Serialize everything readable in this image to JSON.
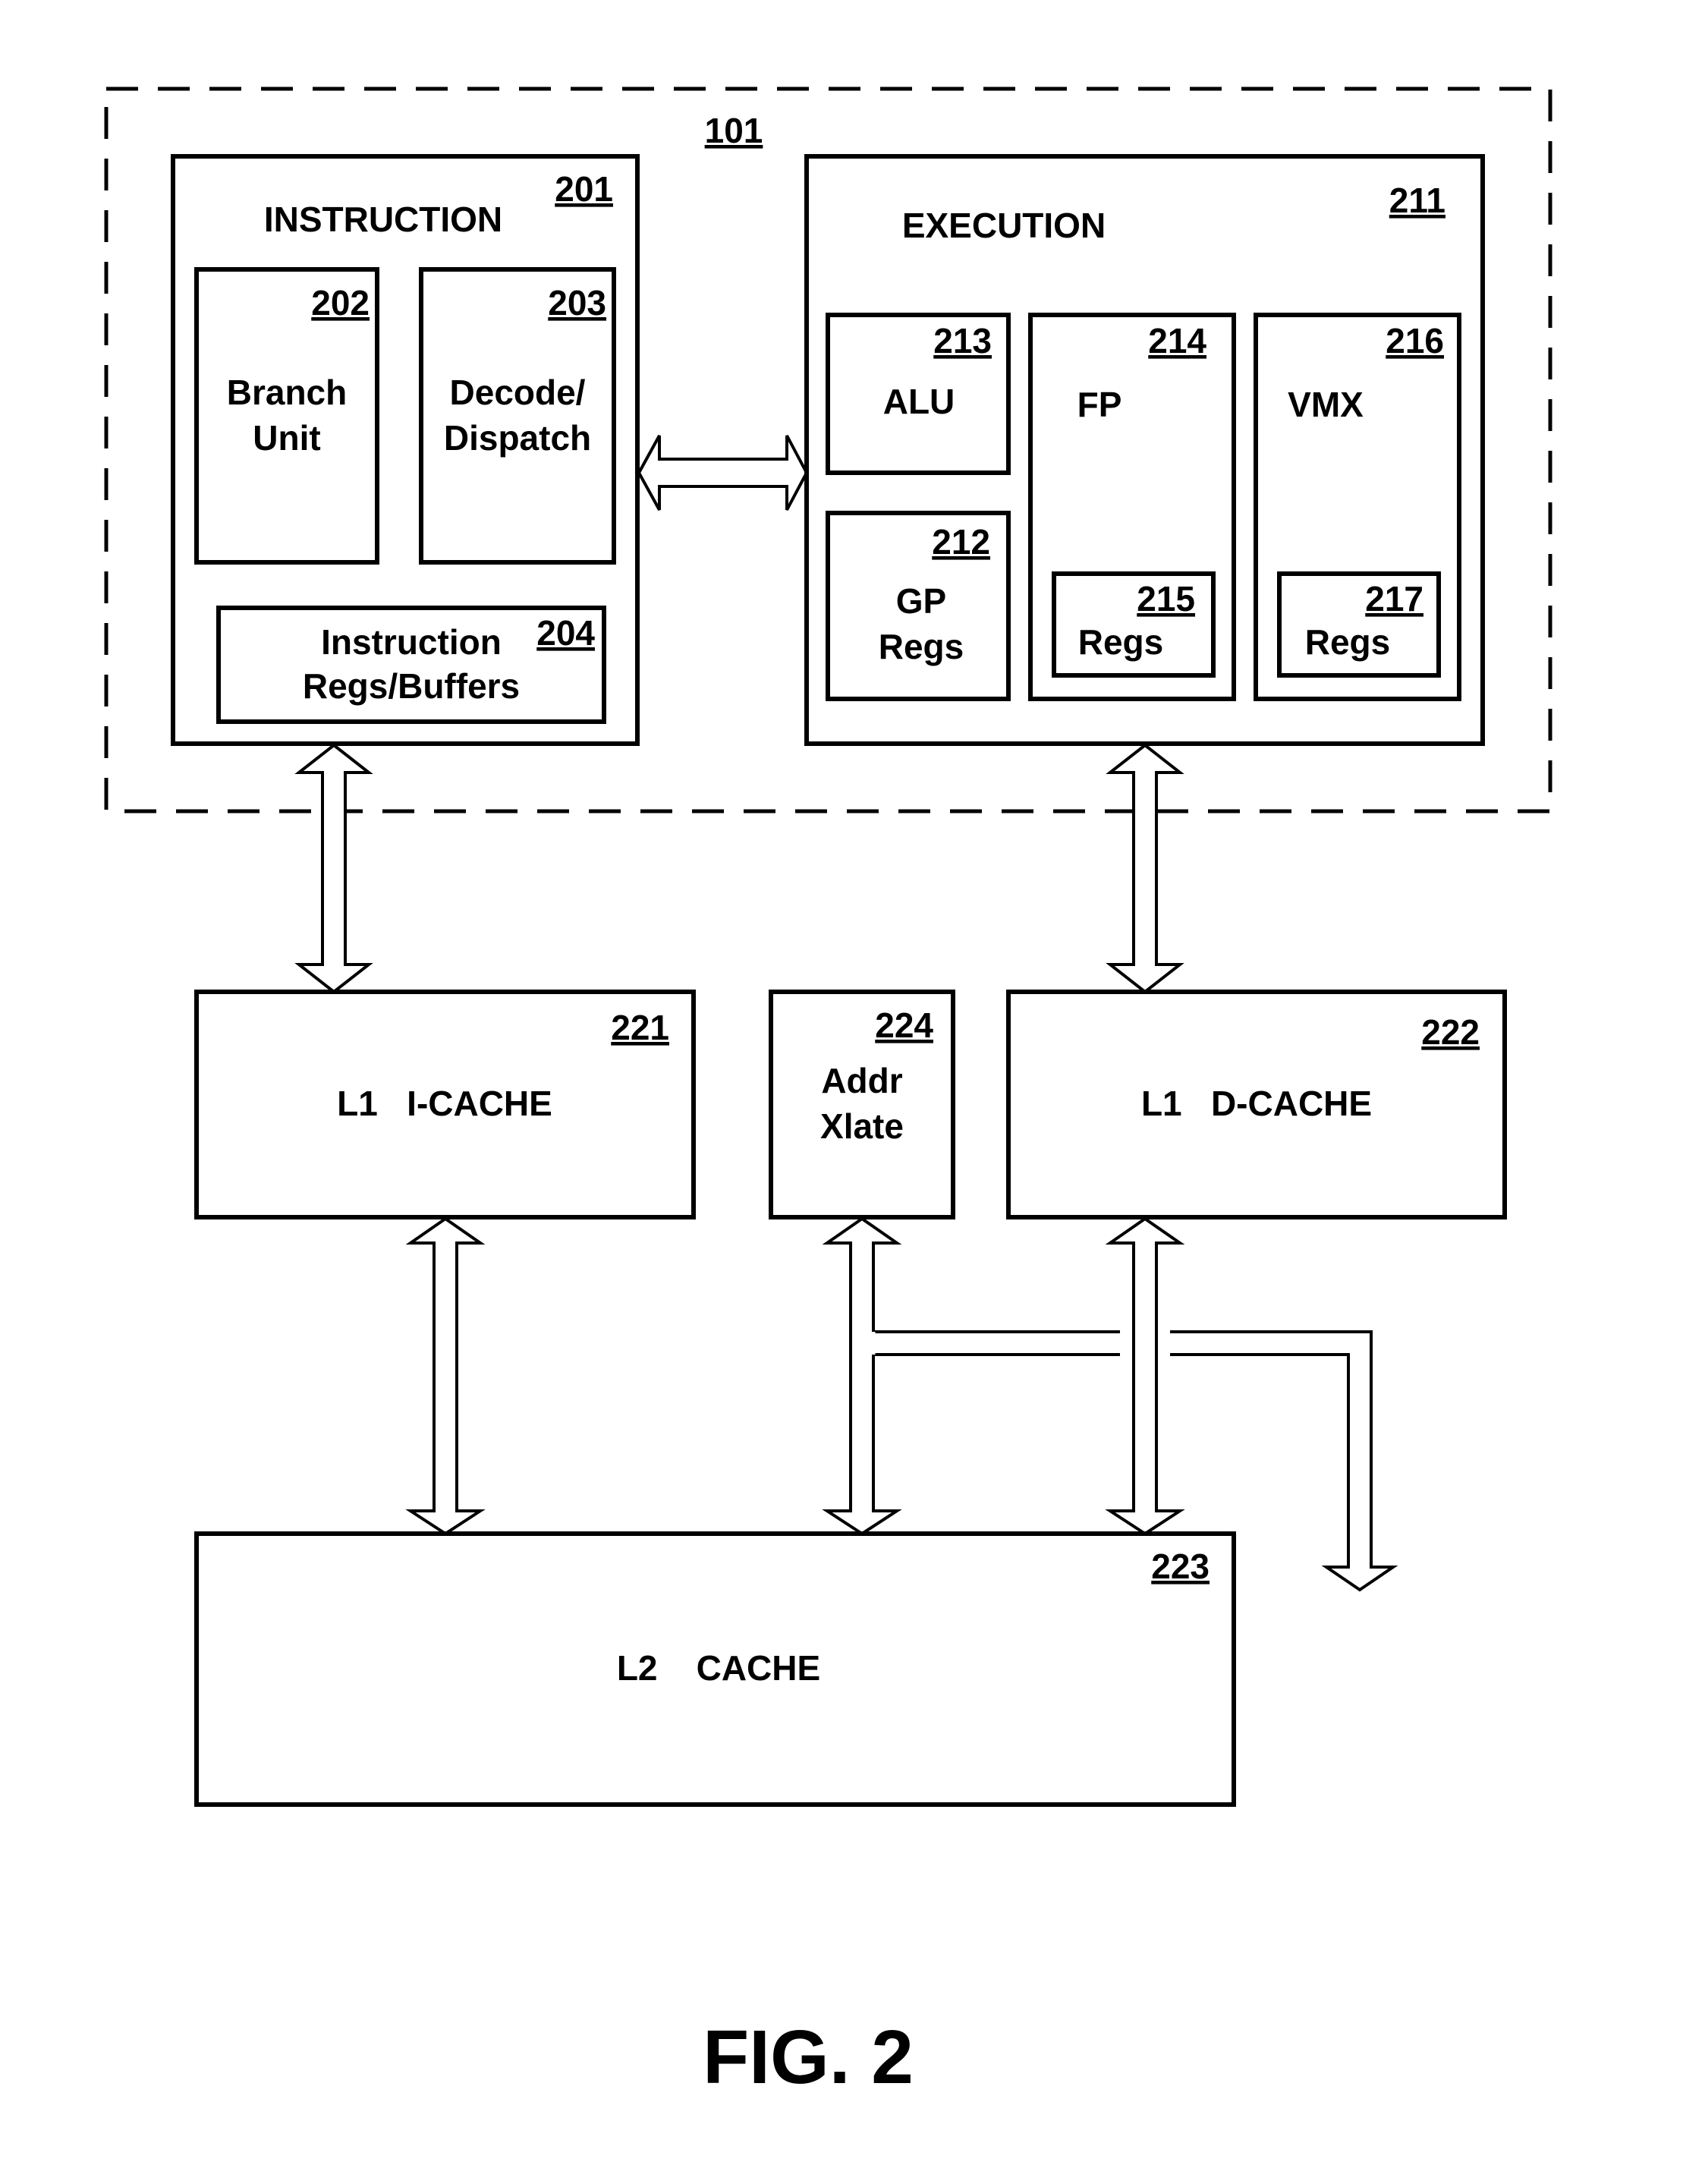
{
  "figure": {
    "caption": "FIG. 2",
    "processor_ref": "101"
  },
  "instruction_unit": {
    "ref": "201",
    "title": "INSTRUCTION",
    "branch_unit": {
      "ref": "202",
      "line1": "Branch",
      "line2": "Unit"
    },
    "decode_dispatch": {
      "ref": "203",
      "line1": "Decode/",
      "line2": "Dispatch"
    },
    "instr_regs": {
      "ref": "204",
      "line1": "Instruction",
      "line2": "Regs/Buffers"
    }
  },
  "execution_unit": {
    "ref": "211",
    "title": "EXECUTION",
    "alu": {
      "ref": "213",
      "label": "ALU"
    },
    "gp_regs": {
      "ref": "212",
      "line1": "GP",
      "line2": "Regs"
    },
    "fp": {
      "ref": "214",
      "label": "FP",
      "regs_ref": "215",
      "regs_label": "Regs"
    },
    "vmx": {
      "ref": "216",
      "label": "VMX",
      "regs_ref": "217",
      "regs_label": "Regs"
    }
  },
  "caches": {
    "l1_icache": {
      "ref": "221",
      "label": "L1   I-CACHE"
    },
    "addr_xlate": {
      "ref": "224",
      "line1": "Addr",
      "line2": "Xlate"
    },
    "l1_dcache": {
      "ref": "222",
      "label": "L1   D-CACHE"
    },
    "l2_cache": {
      "ref": "223",
      "label": "L2    CACHE"
    }
  }
}
